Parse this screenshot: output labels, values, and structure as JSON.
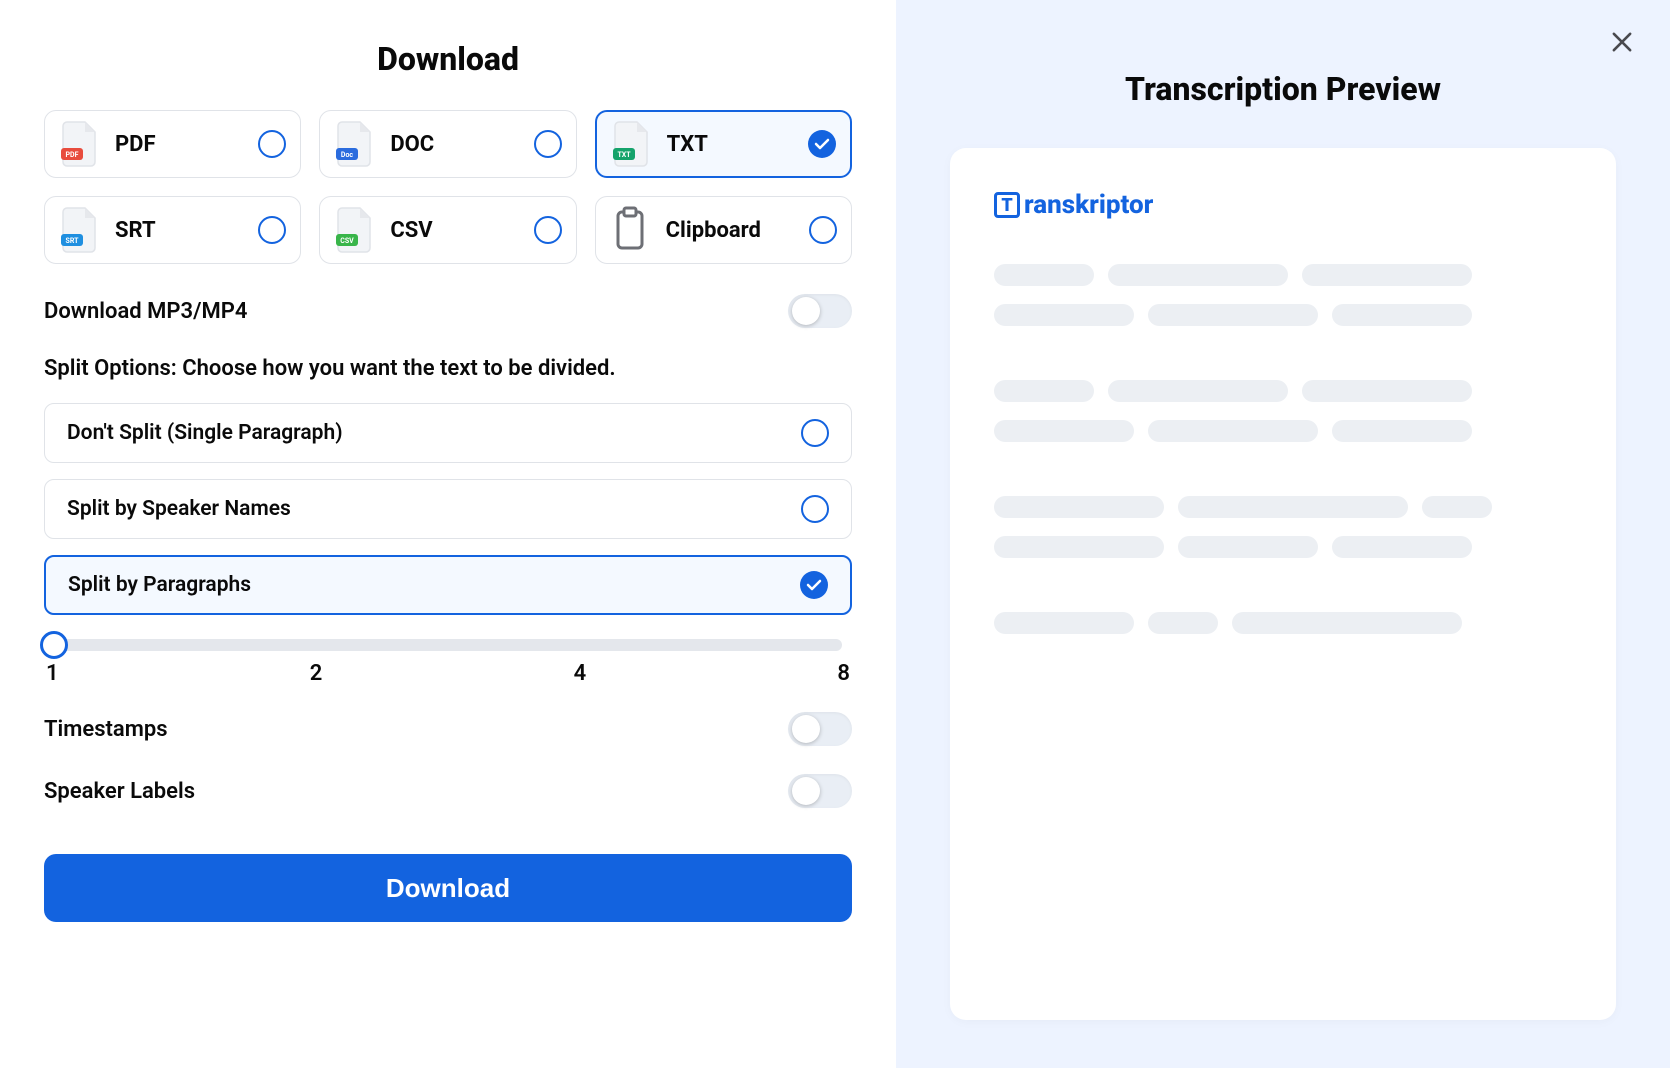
{
  "left": {
    "title": "Download",
    "formats": [
      {
        "label": "PDF",
        "badge_text": "PDF",
        "badge_color": "#E84C3D",
        "icon": "pdf"
      },
      {
        "label": "DOC",
        "badge_text": "Doc",
        "badge_color": "#2B6CDE",
        "icon": "doc"
      },
      {
        "label": "TXT",
        "badge_text": "TXT",
        "badge_color": "#15A36B",
        "icon": "txt",
        "selected": true
      },
      {
        "label": "SRT",
        "badge_text": "SRT",
        "badge_color": "#1F8FE0",
        "icon": "srt"
      },
      {
        "label": "CSV",
        "badge_text": "CSV",
        "badge_color": "#39B54A",
        "icon": "csv"
      },
      {
        "label": "Clipboard",
        "icon": "clipboard"
      }
    ],
    "mp3_toggle_label": "Download MP3/MP4",
    "mp3_toggle_on": false,
    "split_heading": "Split Options: Choose how you want the text to be divided.",
    "split_options": [
      {
        "label": "Don't Split (Single Paragraph)"
      },
      {
        "label": "Split by Speaker Names"
      },
      {
        "label": "Split by Paragraphs",
        "selected": true
      }
    ],
    "slider": {
      "value": 1,
      "ticks": [
        "1",
        "2",
        "4",
        "8"
      ]
    },
    "timestamps_label": "Timestamps",
    "timestamps_on": false,
    "speaker_labels_label": "Speaker Labels",
    "speaker_labels_on": false,
    "download_button_label": "Download"
  },
  "right": {
    "title": "Transcription Preview",
    "brand": "ranskriptor",
    "brand_letter": "T"
  }
}
